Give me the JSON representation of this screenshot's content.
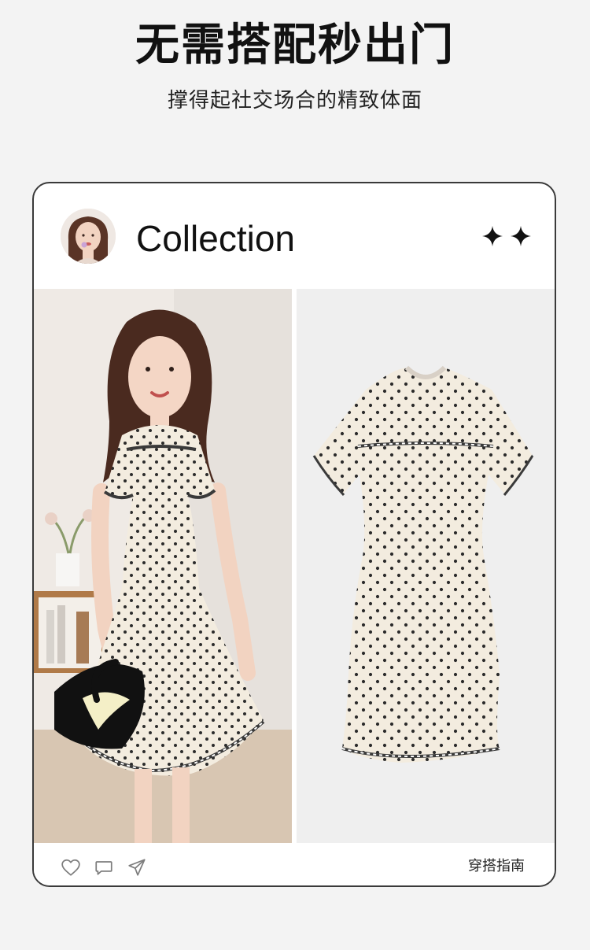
{
  "hero": {
    "headline": "无需搭配秒出门",
    "subheadline": "撑得起社交场合的精致体面"
  },
  "card": {
    "title": "Collection",
    "footer_label": "穿搭指南"
  },
  "icons": {
    "avatar": "model-avatar",
    "sparkles": [
      "sparkle-icon",
      "sparkle-icon"
    ],
    "footer": [
      "heart-icon",
      "comment-icon",
      "send-icon"
    ]
  },
  "colors": {
    "background": "#f3f3f3",
    "card_border": "#3a3a3a",
    "text": "#111111",
    "dress_cream": "#f3ecdf",
    "dot": "#2b2b2b"
  }
}
